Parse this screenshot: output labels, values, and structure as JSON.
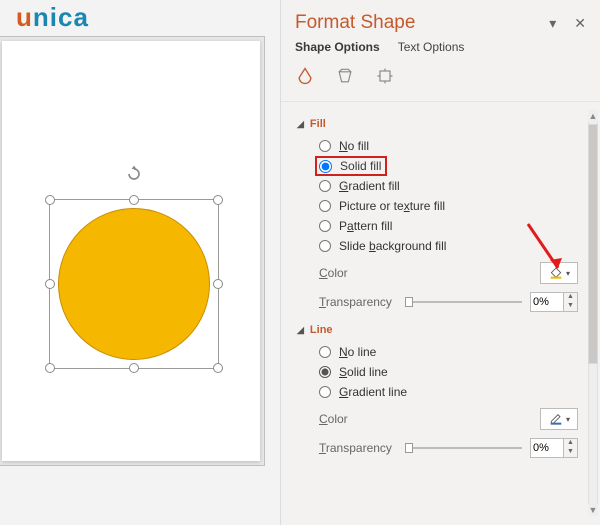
{
  "logo": {
    "pre": "u",
    "rest": "nica"
  },
  "pane": {
    "title": "Format Shape",
    "tabs": {
      "shape": "Shape Options",
      "text": "Text Options"
    }
  },
  "fill": {
    "heading": "Fill",
    "no_fill": "o fill",
    "no_pre": "N",
    "solid": "olid fill",
    "solid_pre": "S",
    "gradient": "radient fill",
    "gradient_pre": "G",
    "picture": "Picture or te",
    "picture_u": "x",
    "picture_post": "ture fill",
    "pattern": "P",
    "pattern_u": "a",
    "pattern_post": "ttern fill",
    "slidebg": "Slide ",
    "slidebg_u": "b",
    "slidebg_post": "ackground fill",
    "color_lbl_u": "C",
    "color_lbl": "olor",
    "trans_lbl_u": "T",
    "trans_lbl": "ransparency",
    "trans_val": "0%"
  },
  "line": {
    "heading": "Line",
    "no_line_u": "N",
    "no_line": "o line",
    "solid_u": "S",
    "solid": "olid line",
    "grad_u": "G",
    "grad": "radient line",
    "color_lbl_u": "C",
    "color_lbl": "olor",
    "trans_lbl_u": "T",
    "trans_lbl": "ransparency",
    "trans_val": "0%"
  },
  "colors": {
    "shape_fill": "#f6b700",
    "accent": "#c55a2d",
    "highlight_border": "#d02020"
  }
}
